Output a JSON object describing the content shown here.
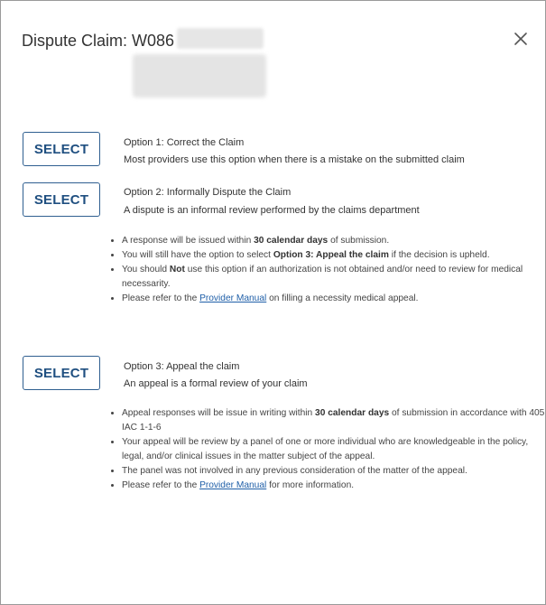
{
  "dialog": {
    "title": "Dispute Claim:  W086",
    "close_icon": "close-icon"
  },
  "options": [
    {
      "button_label": "SELECT",
      "title": "Option 1: Correct the Claim",
      "description": "Most providers use this option when there is a mistake on the submitted claim"
    },
    {
      "button_label": "SELECT",
      "title": "Option 2: Informally Dispute the Claim",
      "description": "A dispute is an informal review performed by the claims department",
      "bullets": {
        "b1": {
          "pre": "A response will be issued within ",
          "bold": "30 calendar days",
          "post": " of submission."
        },
        "b2": {
          "pre": "You will still have the option to select ",
          "bold": "Option 3: Appeal the claim",
          "post": " if the decision is upheld."
        },
        "b3": {
          "pre": "You should ",
          "bold": "Not",
          "post": " use this option if an authorization is not obtained and/or need to review for medical necessarity."
        },
        "b4": {
          "pre": "Please refer to the ",
          "link": "Provider Manual",
          "post": " on filling a necessity medical appeal."
        }
      }
    },
    {
      "button_label": "SELECT",
      "title": "Option 3: Appeal the claim",
      "description": "An appeal is a formal review of your claim",
      "bullets": {
        "b1": {
          "pre": "Appeal responses will be issue in writing within ",
          "bold": "30 calendar days",
          "post": " of submission in accordance with 405 IAC 1-1-6"
        },
        "b2": {
          "text": "Your appeal will be review by a panel of one or more individual who are knowledgeable in the policy, legal, and/or clinical issues in the matter subject of the appeal."
        },
        "b3": {
          "text": "The panel was not involved in any previous consideration of the matter of the appeal."
        },
        "b4": {
          "pre": "Please refer to the ",
          "link": "Provider Manual",
          "post": " for more information."
        }
      }
    }
  ],
  "colors": {
    "button_border": "#2f5f90",
    "button_text": "#1f4f80",
    "link": "#1f5fa8",
    "dialog_border": "#9a9a9a"
  }
}
